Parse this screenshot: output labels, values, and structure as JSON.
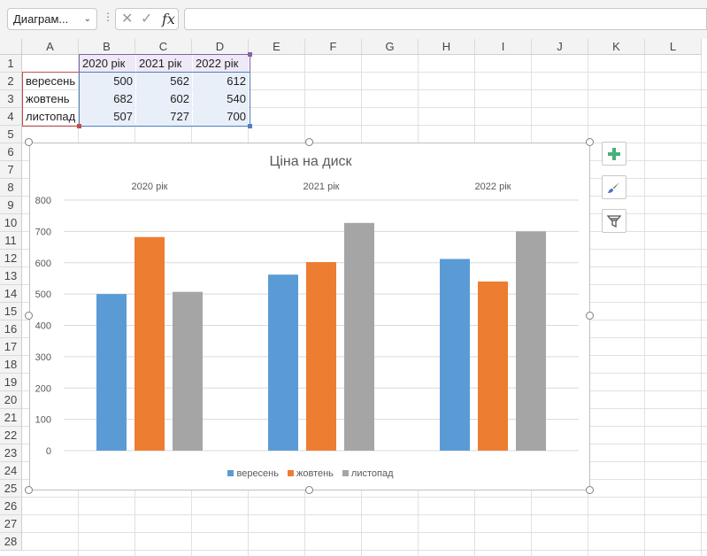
{
  "name_box": "Диаграм...",
  "formula_value": "",
  "columns": [
    "A",
    "B",
    "C",
    "D",
    "E",
    "F",
    "G",
    "H",
    "I",
    "J",
    "K",
    "L"
  ],
  "rows": [
    "1",
    "2",
    "3",
    "4",
    "5",
    "6",
    "7",
    "8",
    "9",
    "10",
    "11",
    "12",
    "13",
    "14",
    "15",
    "16",
    "17",
    "18",
    "19",
    "20",
    "21",
    "22",
    "23",
    "24",
    "25",
    "26",
    "27",
    "28"
  ],
  "table": {
    "headers": [
      "2020 рік",
      "2021 рік",
      "2022 рік"
    ],
    "rows": [
      {
        "label": "вересень",
        "values": [
          "500",
          "562",
          "612"
        ]
      },
      {
        "label": "жовтень",
        "values": [
          "682",
          "602",
          "540"
        ]
      },
      {
        "label": "листопад",
        "values": [
          "507",
          "727",
          "700"
        ]
      }
    ]
  },
  "colors": {
    "series1": "#5b9bd5",
    "series2": "#ed7d31",
    "series3": "#a5a5a5",
    "grid": "#d9d9d9",
    "add_element": "#4caf76"
  },
  "icons": [
    "chart-elements-plus-icon",
    "chart-styles-brush-icon",
    "chart-filters-funnel-icon"
  ],
  "chart_data": {
    "type": "bar",
    "title": "Ціна на диск",
    "categories": [
      "2020 рік",
      "2021 рік",
      "2022 рік"
    ],
    "series": [
      {
        "name": "вересень",
        "values": [
          500,
          562,
          612
        ]
      },
      {
        "name": "жовтень",
        "values": [
          682,
          602,
          540
        ]
      },
      {
        "name": "листопад",
        "values": [
          507,
          727,
          700
        ]
      }
    ],
    "ylim": [
      0,
      800
    ],
    "yticks": [
      0,
      100,
      200,
      300,
      400,
      500,
      600,
      700,
      800
    ],
    "grid": true,
    "category_labels_position": "top",
    "legend": "bottom"
  }
}
